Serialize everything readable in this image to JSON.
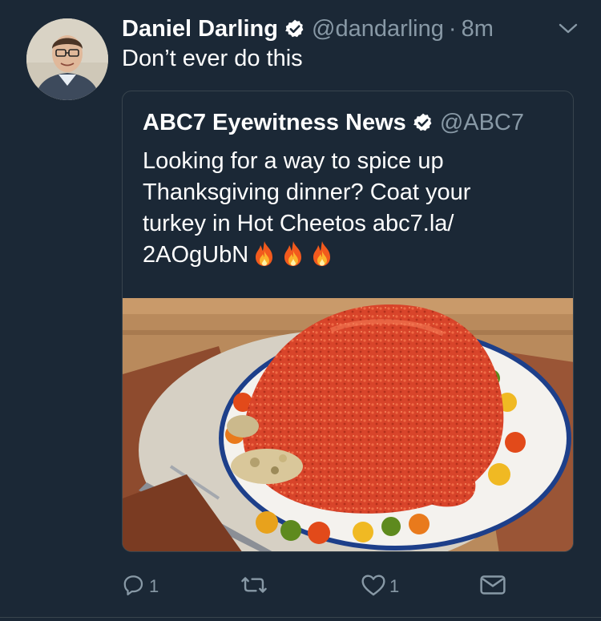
{
  "tweet": {
    "author_name": "Daniel Darling",
    "author_handle": "@dandarling",
    "separator": "·",
    "timestamp": "8m",
    "text": "Don’t ever do this",
    "verified": true
  },
  "quoted_tweet": {
    "author_name": "ABC7 Eyewitness News",
    "author_handle": "@ABC7",
    "verified": true,
    "text_lines": [
      "Looking for a way to spice up",
      "Thanksgiving dinner? Coat your",
      "turkey in Hot Cheetos abc7.la/",
      "2AOgUbN"
    ],
    "emoji": [
      "fire-emoji",
      "fire-emoji",
      "fire-emoji"
    ],
    "image_description_icon": "photo"
  },
  "actions": {
    "reply_count": "1",
    "retweet_count": "",
    "like_count": "1"
  },
  "colors": {
    "background": "#1b2836",
    "muted_text": "#8899a6",
    "border": "#38444d",
    "verified_badge": "#ffffff"
  }
}
